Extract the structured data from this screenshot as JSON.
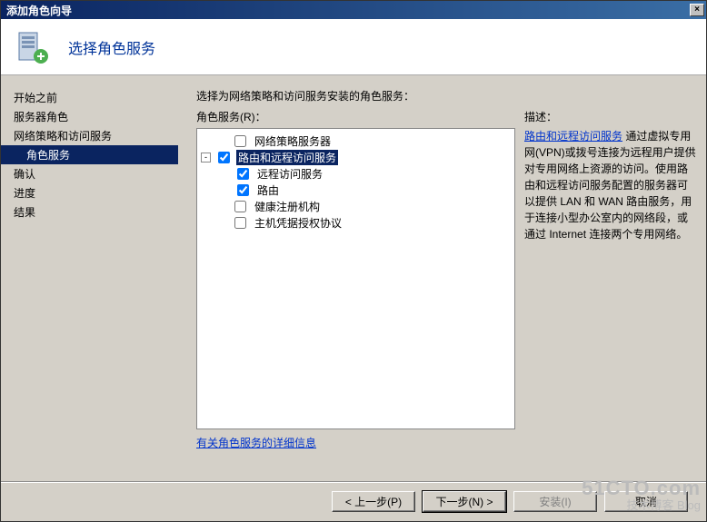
{
  "window": {
    "title": "添加角色向导",
    "close_glyph": "×"
  },
  "header": {
    "title": "选择角色服务"
  },
  "sidebar": {
    "items": [
      {
        "label": "开始之前",
        "active": false,
        "indent": false
      },
      {
        "label": "服务器角色",
        "active": false,
        "indent": false
      },
      {
        "label": "网络策略和访问服务",
        "active": false,
        "indent": false
      },
      {
        "label": "角色服务",
        "active": true,
        "indent": true
      },
      {
        "label": "确认",
        "active": false,
        "indent": false
      },
      {
        "label": "进度",
        "active": false,
        "indent": false
      },
      {
        "label": "结果",
        "active": false,
        "indent": false
      }
    ]
  },
  "main": {
    "instruction": "选择为网络策略和访问服务安装的角色服务：",
    "tree_label": "角色服务(R)：",
    "tree": [
      {
        "level": 1,
        "checked": false,
        "label": "网络策略服务器",
        "selected": false,
        "expander": ""
      },
      {
        "level": 1,
        "checked": true,
        "label": "路由和远程访问服务",
        "selected": true,
        "expander": "-"
      },
      {
        "level": 2,
        "checked": true,
        "label": "远程访问服务",
        "selected": false,
        "expander": ""
      },
      {
        "level": 2,
        "checked": true,
        "label": "路由",
        "selected": false,
        "expander": ""
      },
      {
        "level": 1,
        "checked": false,
        "label": "健康注册机构",
        "selected": false,
        "expander": ""
      },
      {
        "level": 1,
        "checked": false,
        "label": "主机凭据授权协议",
        "selected": false,
        "expander": ""
      }
    ],
    "more_link": "有关角色服务的详细信息"
  },
  "description": {
    "title": "描述：",
    "link_text": "路由和远程访问服务",
    "body_rest": " 通过虚拟专用网(VPN)或拨号连接为远程用户提供对专用网络上资源的访问。使用路由和远程访问服务配置的服务器可以提供 LAN 和 WAN 路由服务，用于连接小型办公室内的网络段，或通过 Internet 连接两个专用网络。"
  },
  "footer": {
    "prev": "< 上一步(P)",
    "next": "下一步(N) >",
    "install": "安装(I)",
    "cancel": "取消"
  },
  "watermark": {
    "big": "51CTO.com",
    "small": "技术博客  Blog"
  }
}
